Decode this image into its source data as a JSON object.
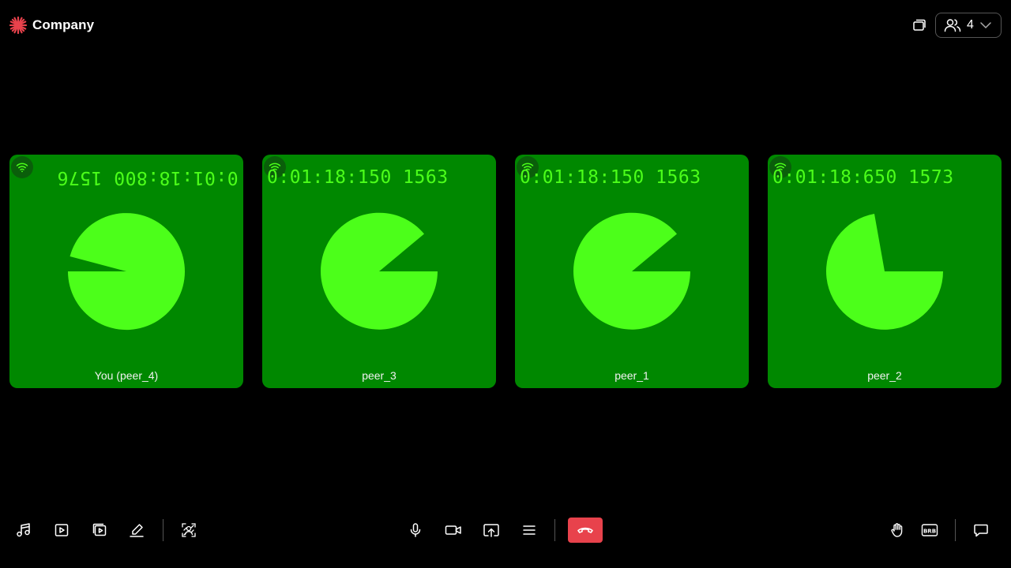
{
  "brand": {
    "name": "Company",
    "accent": "#e8424c"
  },
  "header": {
    "participant_count": "4"
  },
  "tiles": [
    {
      "name": "You (peer_4)",
      "timer": "0:01:18:800 1576",
      "mirrored": true
    },
    {
      "name": "peer_3",
      "timer": "0:01:18:150 1563",
      "mirrored": false
    },
    {
      "name": "peer_1",
      "timer": "0:01:18:150 1563",
      "mirrored": false
    },
    {
      "name": "peer_2",
      "timer": "0:01:18:650 1573",
      "mirrored": false
    }
  ],
  "colors": {
    "tile_bg": "#008800",
    "pie": "#4cff1a",
    "page_bg": "#000000",
    "end_call": "#e8424c"
  },
  "toolbar": {
    "left": [
      "music-icon",
      "video-playlist-icon",
      "embed-video-icon",
      "whiteboard-icon",
      "virtual-background-icon"
    ],
    "center": [
      "microphone-icon",
      "camera-icon",
      "screen-share-icon",
      "more-menu-icon",
      "end-call-icon"
    ],
    "right": [
      "raise-hand-icon",
      "brb-icon",
      "chat-icon"
    ]
  }
}
